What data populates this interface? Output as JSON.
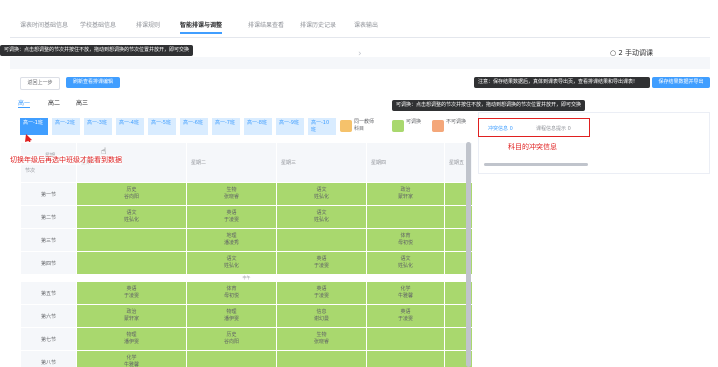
{
  "nav": {
    "tabs": [
      "课表时间基础信息",
      "学校基础信息",
      "排课规则",
      "智能排课与调整",
      "排课结果查看",
      "排课历史记录",
      "课表输出"
    ]
  },
  "tooltip_top": "可调换：点击想调整的节次并按住不放，拖动到想调换的节次位置并放开，即可交换",
  "manual_adjust": "2 手动调课",
  "buttons": {
    "prev_step": "返回上一步",
    "refresh": "刷新查看排课编辑",
    "export_note": "注意：保存结果数据后，真体到课表导出页，查看排课结果和导出课表!",
    "export_btn": "保存结果数据并导出"
  },
  "grades": [
    "高一",
    "高二",
    "高三"
  ],
  "classes": [
    "高一-1班",
    "高一-2班",
    "高一-3班",
    "高一-4班",
    "高一-5班",
    "高一-6班",
    "高一-7班",
    "高一-8班",
    "高一-9班",
    "高一-10班"
  ],
  "legend": {
    "same_teacher": "同一教师科目",
    "swappable": "可调换",
    "not_swappable": "不可调换",
    "colors": {
      "same_teacher": "#f5c26b",
      "swappable": "#a9d86e",
      "not_swappable": "#f4a77a"
    }
  },
  "tooltip_mid": "可调换：点击想调整的节次并按住不放，拖动到想调换的节次位置并放开，即可交换",
  "annotations": {
    "left": "切换年级后再选中班级才能看到数据",
    "right": "科目的冲突信息"
  },
  "panel_tabs": [
    "冲突信息 0",
    "课程信息提示 0"
  ],
  "table": {
    "corner_top": "星期",
    "corner_bottom": "节次",
    "days": [
      "星期一",
      "星期二",
      "星期三",
      "星期四",
      "星期五"
    ],
    "noon": "中午",
    "rows": [
      {
        "period": "第一节",
        "cells": [
          "历史\n谷向阳",
          "生物\n张晓睿",
          "语文\n姓弘化",
          "政治\n蒙轩家"
        ]
      },
      {
        "period": "第二节",
        "cells": [
          "语文\n姓弘化",
          "英语\n于凌雯",
          "语文\n姓弘化",
          ""
        ]
      },
      {
        "period": "第三节",
        "cells": [
          "",
          "地理\n潘凌秀",
          "",
          "体育\n母初悦"
        ]
      },
      {
        "period": "第四节",
        "cells": [
          "",
          "语文\n姓弘化",
          "英语\n于凌雯",
          "语文\n姓弘化"
        ]
      },
      {
        "period": "第五节",
        "cells": [
          "英语\n于凌雯",
          "体育\n母初悦",
          "英语\n于凌雯",
          "化学\n牛雅馨"
        ]
      },
      {
        "period": "第六节",
        "cells": [
          "政治\n蒙轩家",
          "物理\n潘伊雯",
          "信息\n谢幻曼",
          "英语\n于凌雯"
        ]
      },
      {
        "period": "第七节",
        "cells": [
          "物理\n潘伊雯",
          "历史\n谷向阳",
          "生物\n张晓睿",
          ""
        ]
      },
      {
        "period": "第八节",
        "cells": [
          "化学\n牛雅馨",
          "",
          "",
          ""
        ]
      }
    ]
  }
}
